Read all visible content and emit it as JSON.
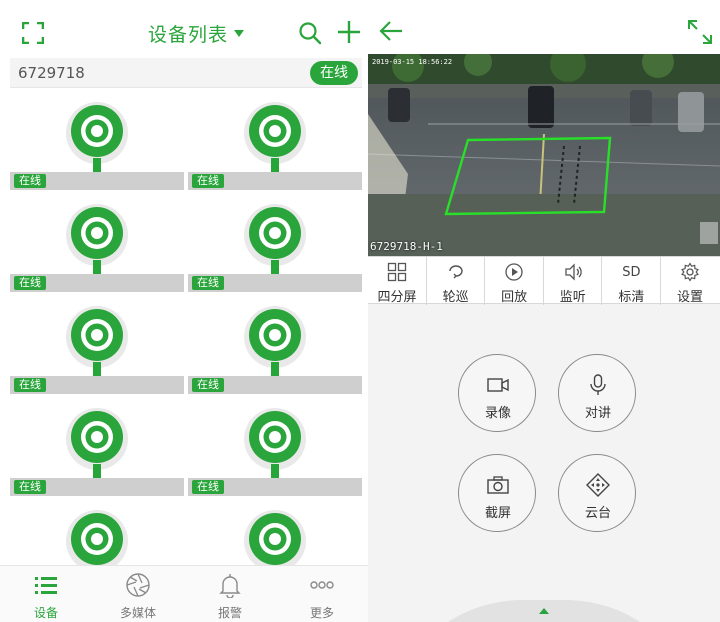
{
  "left": {
    "header": {
      "title": "设备列表"
    },
    "device_bar": {
      "id": "6729718",
      "status": "在线"
    },
    "cells": [
      {
        "status": "在线"
      },
      {
        "status": "在线"
      },
      {
        "status": "在线"
      },
      {
        "status": "在线"
      },
      {
        "status": "在线"
      },
      {
        "status": "在线"
      },
      {
        "status": "在线"
      },
      {
        "status": "在线"
      },
      {
        "status": ""
      },
      {
        "status": ""
      }
    ],
    "tabs": [
      {
        "label": "设备",
        "icon": "list-icon"
      },
      {
        "label": "多媒体",
        "icon": "shutter-icon"
      },
      {
        "label": "报警",
        "icon": "bell-icon"
      },
      {
        "label": "更多",
        "icon": "more-icon"
      }
    ]
  },
  "right": {
    "video": {
      "osd_top": "2019-03-15 18:56:22",
      "osd_name": "6729718-H-1"
    },
    "toolbar": [
      {
        "label": "四分屏",
        "icon": "quad-screen-icon"
      },
      {
        "label": "轮巡",
        "icon": "patrol-icon"
      },
      {
        "label": "回放",
        "icon": "playback-icon"
      },
      {
        "label": "监听",
        "icon": "speaker-icon"
      },
      {
        "label": "标清",
        "icon": "sd-quality-icon",
        "badge": "SD"
      },
      {
        "label": "设置",
        "icon": "gear-icon"
      }
    ],
    "controls": [
      {
        "label": "录像",
        "icon": "video-camera-icon"
      },
      {
        "label": "对讲",
        "icon": "microphone-icon"
      },
      {
        "label": "截屏",
        "icon": "camera-icon"
      },
      {
        "label": "云台",
        "icon": "ptz-icon"
      }
    ]
  },
  "colors": {
    "accent": "#2aa53b",
    "strip": "#cfcfcf",
    "zone": "#28e028"
  }
}
